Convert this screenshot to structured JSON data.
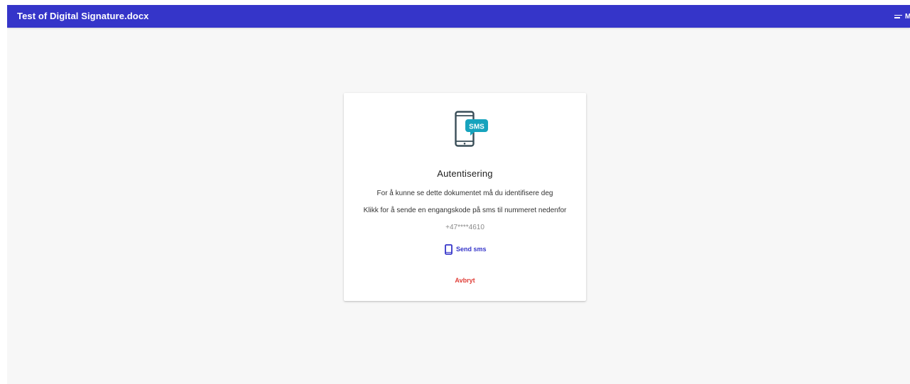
{
  "header": {
    "document_title": "Test of Digital Signature.docx",
    "menu_label": "Me",
    "menu_icon": "menu-icon",
    "background_color": "#3535c9"
  },
  "auth_card": {
    "illustration_icon": "sms-phone-icon",
    "illustration_badge": "SMS",
    "title": "Autentisering",
    "description": "For å kunne se dette dokumentet må du identifisere deg",
    "instruction": "Klikk for å sende en engangskode på sms til nummeret nedenfor",
    "phone_number": "+47****4610",
    "send_button": {
      "icon": "mobile-phone-icon",
      "label": "Send sms",
      "color": "#3535c9"
    },
    "cancel_button": {
      "label": "Avbryt",
      "color": "#e0403a"
    }
  }
}
